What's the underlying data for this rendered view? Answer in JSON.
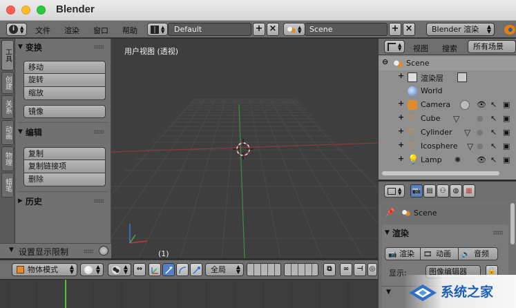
{
  "window": {
    "title": "Blender"
  },
  "menu": [
    "文件",
    "渲染",
    "窗口",
    "帮助"
  ],
  "screen_layout": {
    "value": "Default"
  },
  "scene_selector": {
    "value": "Scene"
  },
  "render_engine": {
    "value": "Blender 渲染"
  },
  "tool_tabs": [
    "工具",
    "创建",
    "关系",
    "动画",
    "物理",
    "蜡笔"
  ],
  "toolshelf": {
    "transform": {
      "title": "变换",
      "items": [
        "移动",
        "旋转",
        "缩放"
      ],
      "mirror": "镜像"
    },
    "edit": {
      "title": "编辑",
      "items": [
        "复制",
        "复制链接项",
        "删除"
      ]
    },
    "history": {
      "title": "历史"
    }
  },
  "limit_bar": {
    "label": "设置显示限制"
  },
  "viewport": {
    "title": "用户视图 (透视)",
    "frame": "(1)"
  },
  "viewport_header": {
    "mode": "物体模式",
    "pivot": "全局"
  },
  "outliner": {
    "view_label": "视图",
    "search_label": "搜索",
    "filter": "所有场景",
    "scene": "Scene",
    "render_layers": "渲染层",
    "world": "World",
    "objects": [
      "Camera",
      "Cube",
      "Cylinder",
      "Icosphere",
      "Lamp"
    ]
  },
  "properties": {
    "scene_path": "Scene",
    "render_panel": "渲染",
    "buttons": [
      "渲染",
      "动画",
      "音频"
    ],
    "display_label": "显示:",
    "display_value": "图像编辑器"
  },
  "watermark": {
    "text": "系统之家"
  },
  "colors": {
    "accent": "#5680c2",
    "x_axis": "#b33a3a",
    "y_axis": "#3c9a3c",
    "timeline_frame": "#59c236"
  }
}
